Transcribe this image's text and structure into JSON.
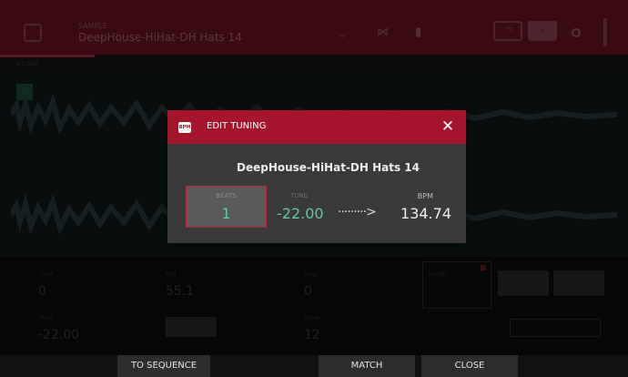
{
  "header": {
    "label": "SAMPLE",
    "sample_title": "DeepHouse-HiHat-DH Hats 14",
    "caret": "⌄",
    "snap_icon": "⋈",
    "trash_icon": "▮",
    "headphones_icon": "◠",
    "zoom_icon": "⌕"
  },
  "ruler": {
    "label": "1.1.000"
  },
  "bottom": {
    "labels": [
      "Start",
      "End",
      "Loop",
      "Tune",
      "Slices",
      "Length"
    ],
    "values": [
      "0",
      "55.1",
      "0",
      "-22.00",
      "12"
    ]
  },
  "modal": {
    "icon_text": "BPM",
    "title": "Edit Tuning",
    "sample_name": "DeepHouse-HiHat-DH Hats 14",
    "beats_label": "Beats",
    "beats_value": "1",
    "tune_label": "Tune",
    "tune_value": "-22.00",
    "arrow": "·········>",
    "bpm_label": "BPM",
    "bpm_value": "134.74",
    "close_icon": "✕"
  },
  "footer": {
    "to_sequence": "To Sequence",
    "match": "Match",
    "close": "Close"
  },
  "colors": {
    "accent": "#a5162c",
    "value_green": "#5fc9a5",
    "modal_bg": "#3a3a3a"
  }
}
